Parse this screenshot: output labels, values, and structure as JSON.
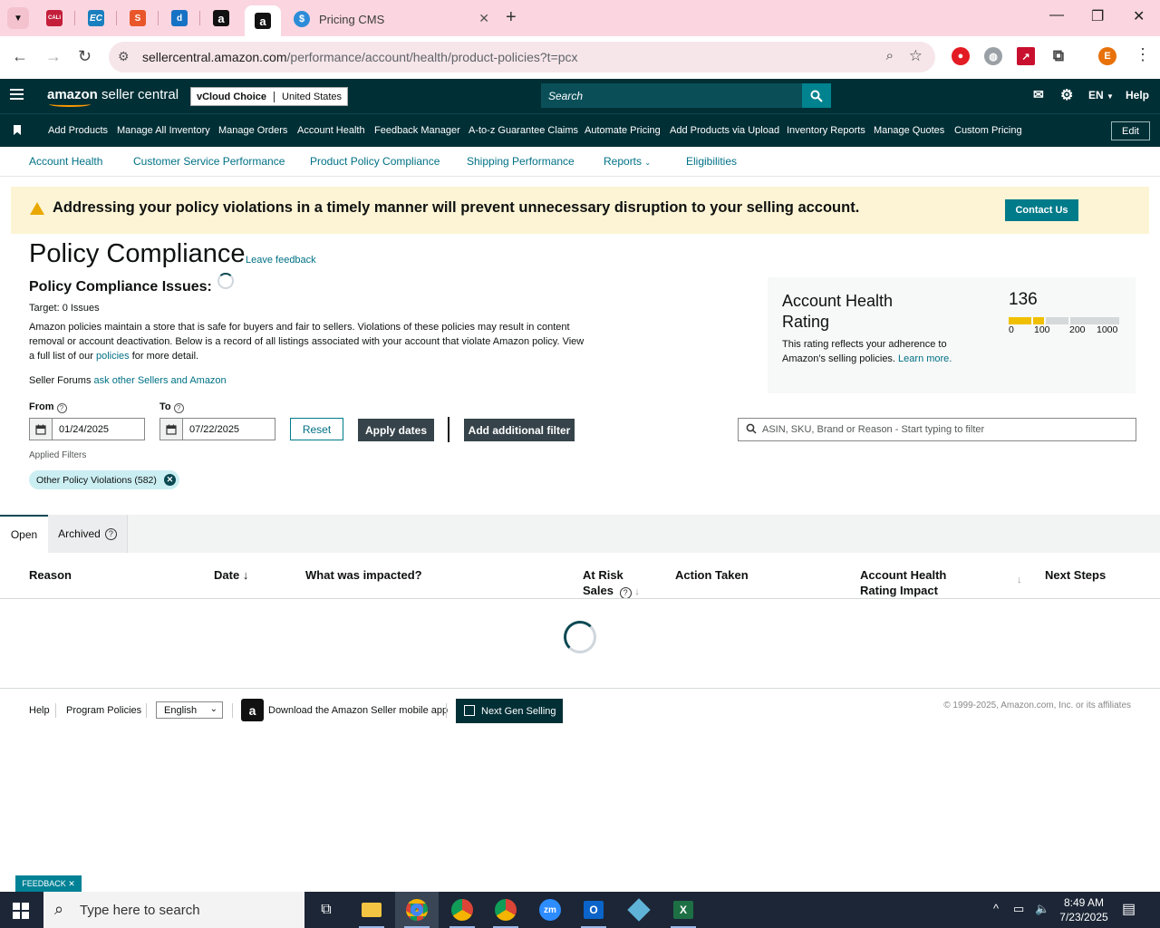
{
  "browser": {
    "pinned_tabs": [
      {
        "name": "tab-cali",
        "label": "CALI",
        "color": "#c41e3a"
      },
      {
        "name": "tab-ec",
        "label": "EC",
        "color": "#1a7fbf"
      },
      {
        "name": "tab-s",
        "label": "S",
        "color": "#e8562a"
      },
      {
        "name": "tab-d",
        "label": "d",
        "color": "#1672c4"
      },
      {
        "name": "tab-amazon-1",
        "label": "a",
        "color": "#111111"
      }
    ],
    "active_tab_label": "a",
    "tab_title": "Pricing CMS",
    "url_host": "sellercentral.amazon.com",
    "url_path": "/performance/account/health/product-policies?t=pcx",
    "profile_initial": "E"
  },
  "header": {
    "logo_primary": "amazon",
    "logo_secondary": " seller central",
    "store_name": "vCloud Choice",
    "store_country": "United States",
    "search_placeholder": "Search",
    "language": "EN",
    "help": "Help"
  },
  "nav": {
    "items": [
      "Add Products",
      "Manage All Inventory",
      "Manage Orders",
      "Account Health",
      "Feedback Manager",
      "A-to-z Guarantee Claims",
      "Automate Pricing",
      "Add Products via Upload",
      "Inventory Reports",
      "Manage Quotes",
      "Custom Pricing"
    ],
    "edit": "Edit"
  },
  "subnav": {
    "items": [
      "Account Health",
      "Customer Service Performance",
      "Product Policy Compliance",
      "Shipping Performance",
      "Reports",
      "Eligibilities"
    ]
  },
  "alert": {
    "message": "Addressing your policy violations in a timely manner will prevent unnecessary disruption to your selling account.",
    "button": "Contact Us"
  },
  "page": {
    "title": "Policy Compliance",
    "leave_feedback": "Leave feedback",
    "issues_title": "Policy Compliance Issues:",
    "target_label": "Target:",
    "target_value": "0 Issues",
    "desc_1": "Amazon policies maintain a store that is safe for buyers and fair to sellers. Violations of these policies may result in content removal or account deactivation. Below is a record of all listings associated with your account that violate Amazon policy. View a full list of our ",
    "desc_link": "policies",
    "desc_2": " for more detail.",
    "forums_label": "Seller Forums ",
    "forums_link": "ask other Sellers and Amazon"
  },
  "ahr": {
    "title": "Account Health Rating",
    "score": "136",
    "desc": "This rating reflects your adherence to Amazon's selling policies. ",
    "learn_more": "Learn more.",
    "ticks": [
      "0",
      "100",
      "200",
      "1000"
    ],
    "colors": {
      "filled": "#f0c000",
      "empty": "#d5d9d9"
    }
  },
  "filters": {
    "from_label": "From",
    "to_label": "To",
    "from_value": "01/24/2025",
    "to_value": "07/22/2025",
    "reset": "Reset",
    "apply": "Apply dates",
    "add_filter": "Add additional filter",
    "search_placeholder": "ASIN, SKU, Brand or Reason - Start typing to filter",
    "applied_label": "Applied Filters",
    "chip": "Other Policy Violations (582)"
  },
  "tabs": {
    "open": "Open",
    "archived": "Archived"
  },
  "table": {
    "headers": {
      "reason": "Reason",
      "date": "Date",
      "impacted": "What was impacted?",
      "at_risk_1": "At Risk",
      "at_risk_2": "Sales",
      "action": "Action Taken",
      "ahr_impact_1": "Account Health",
      "ahr_impact_2": "Rating Impact",
      "next": "Next Steps"
    }
  },
  "footer": {
    "help": "Help",
    "program_policies": "Program Policies",
    "language": "English",
    "download": "Download the Amazon Seller mobile app",
    "next_gen": "Next Gen Selling",
    "copyright": "© 1999-2025, Amazon.com, Inc. or its affiliates"
  },
  "feedback_tab": "FEEDBACK ✕",
  "taskbar": {
    "search_placeholder": "Type here to search",
    "time": "8:49 AM",
    "date": "7/23/2025"
  }
}
